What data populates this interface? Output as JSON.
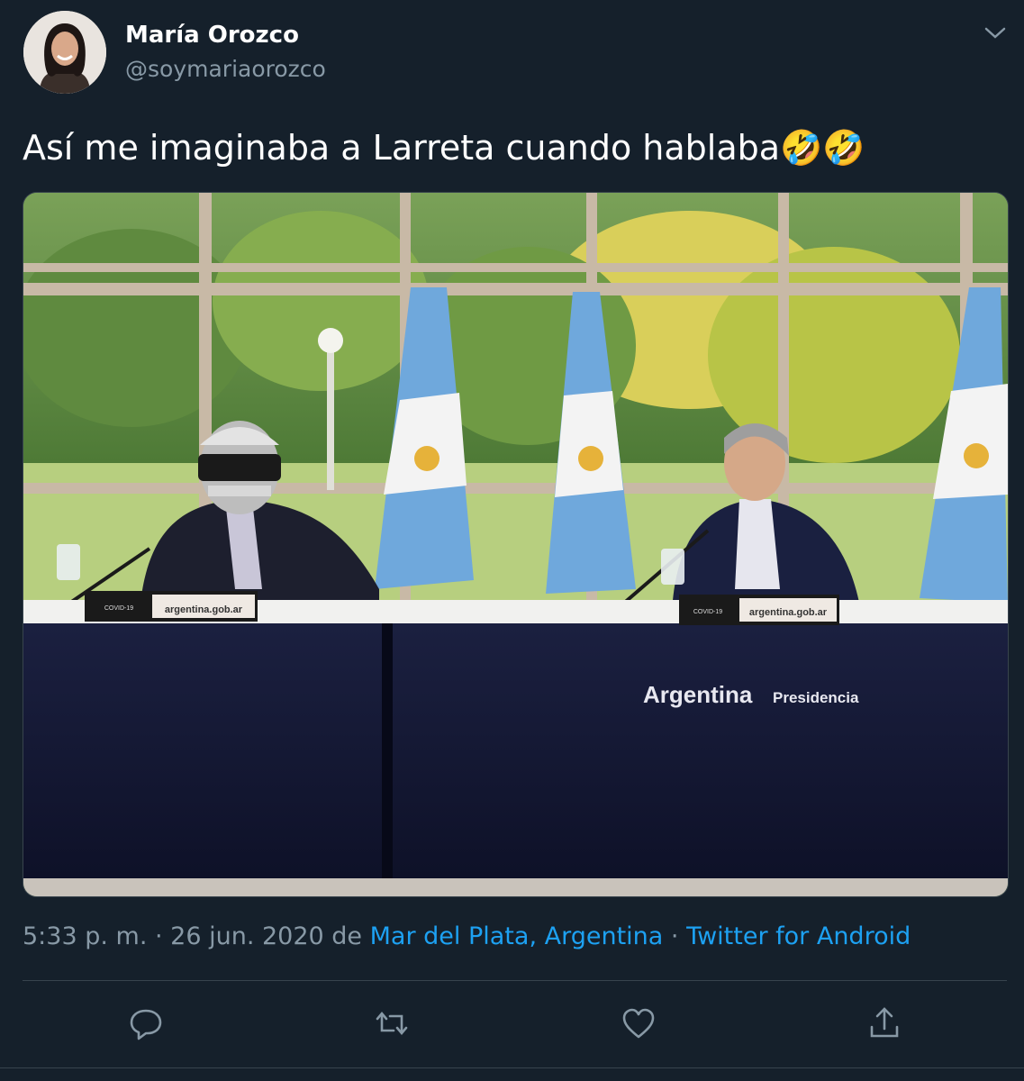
{
  "tweet": {
    "author_name": "María Orozco",
    "author_handle": "@soymariaorozco",
    "text": "Así me imaginaba a Larreta cuando hablaba🤣🤣",
    "time": "5:33 p. m.",
    "sep1": " · ",
    "date": "26 jun. 2020",
    "from_word": " de ",
    "location": "Mar del Plata, Argentina",
    "sep2": " · ",
    "source": "Twitter for Android"
  },
  "media": {
    "placard_left": "argentina.gob.ar",
    "placard_right": "argentina.gob.ar",
    "banner_main": "Argentina",
    "banner_sub": "Presidencia",
    "placard_small": "COVID-19"
  },
  "actions": [
    {
      "icon": "reply-icon"
    },
    {
      "icon": "retweet-icon"
    },
    {
      "icon": "like-icon"
    },
    {
      "icon": "share-icon"
    }
  ],
  "colors": {
    "background": "#15202b",
    "link": "#1da1f2",
    "secondary_text": "#8899a6",
    "divider": "#38444d"
  }
}
